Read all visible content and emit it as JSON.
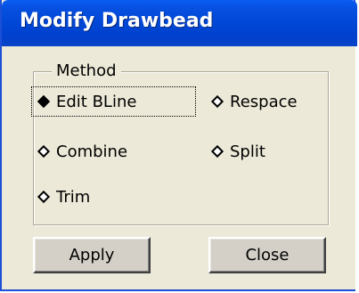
{
  "window": {
    "title": "Modify Drawbead"
  },
  "method_group": {
    "label": "Method",
    "options": [
      {
        "label": "Edit BLine",
        "selected": true,
        "focused": true
      },
      {
        "label": "Respace",
        "selected": false
      },
      {
        "label": "Combine",
        "selected": false
      },
      {
        "label": "Split",
        "selected": false
      },
      {
        "label": "Trim",
        "selected": false
      }
    ]
  },
  "buttons": {
    "apply_label": "Apply",
    "close_label": "Close"
  },
  "colors": {
    "titlebar": "#0047d6",
    "dialog_background": "#ece9d8",
    "button_face": "#d4d0c8"
  }
}
